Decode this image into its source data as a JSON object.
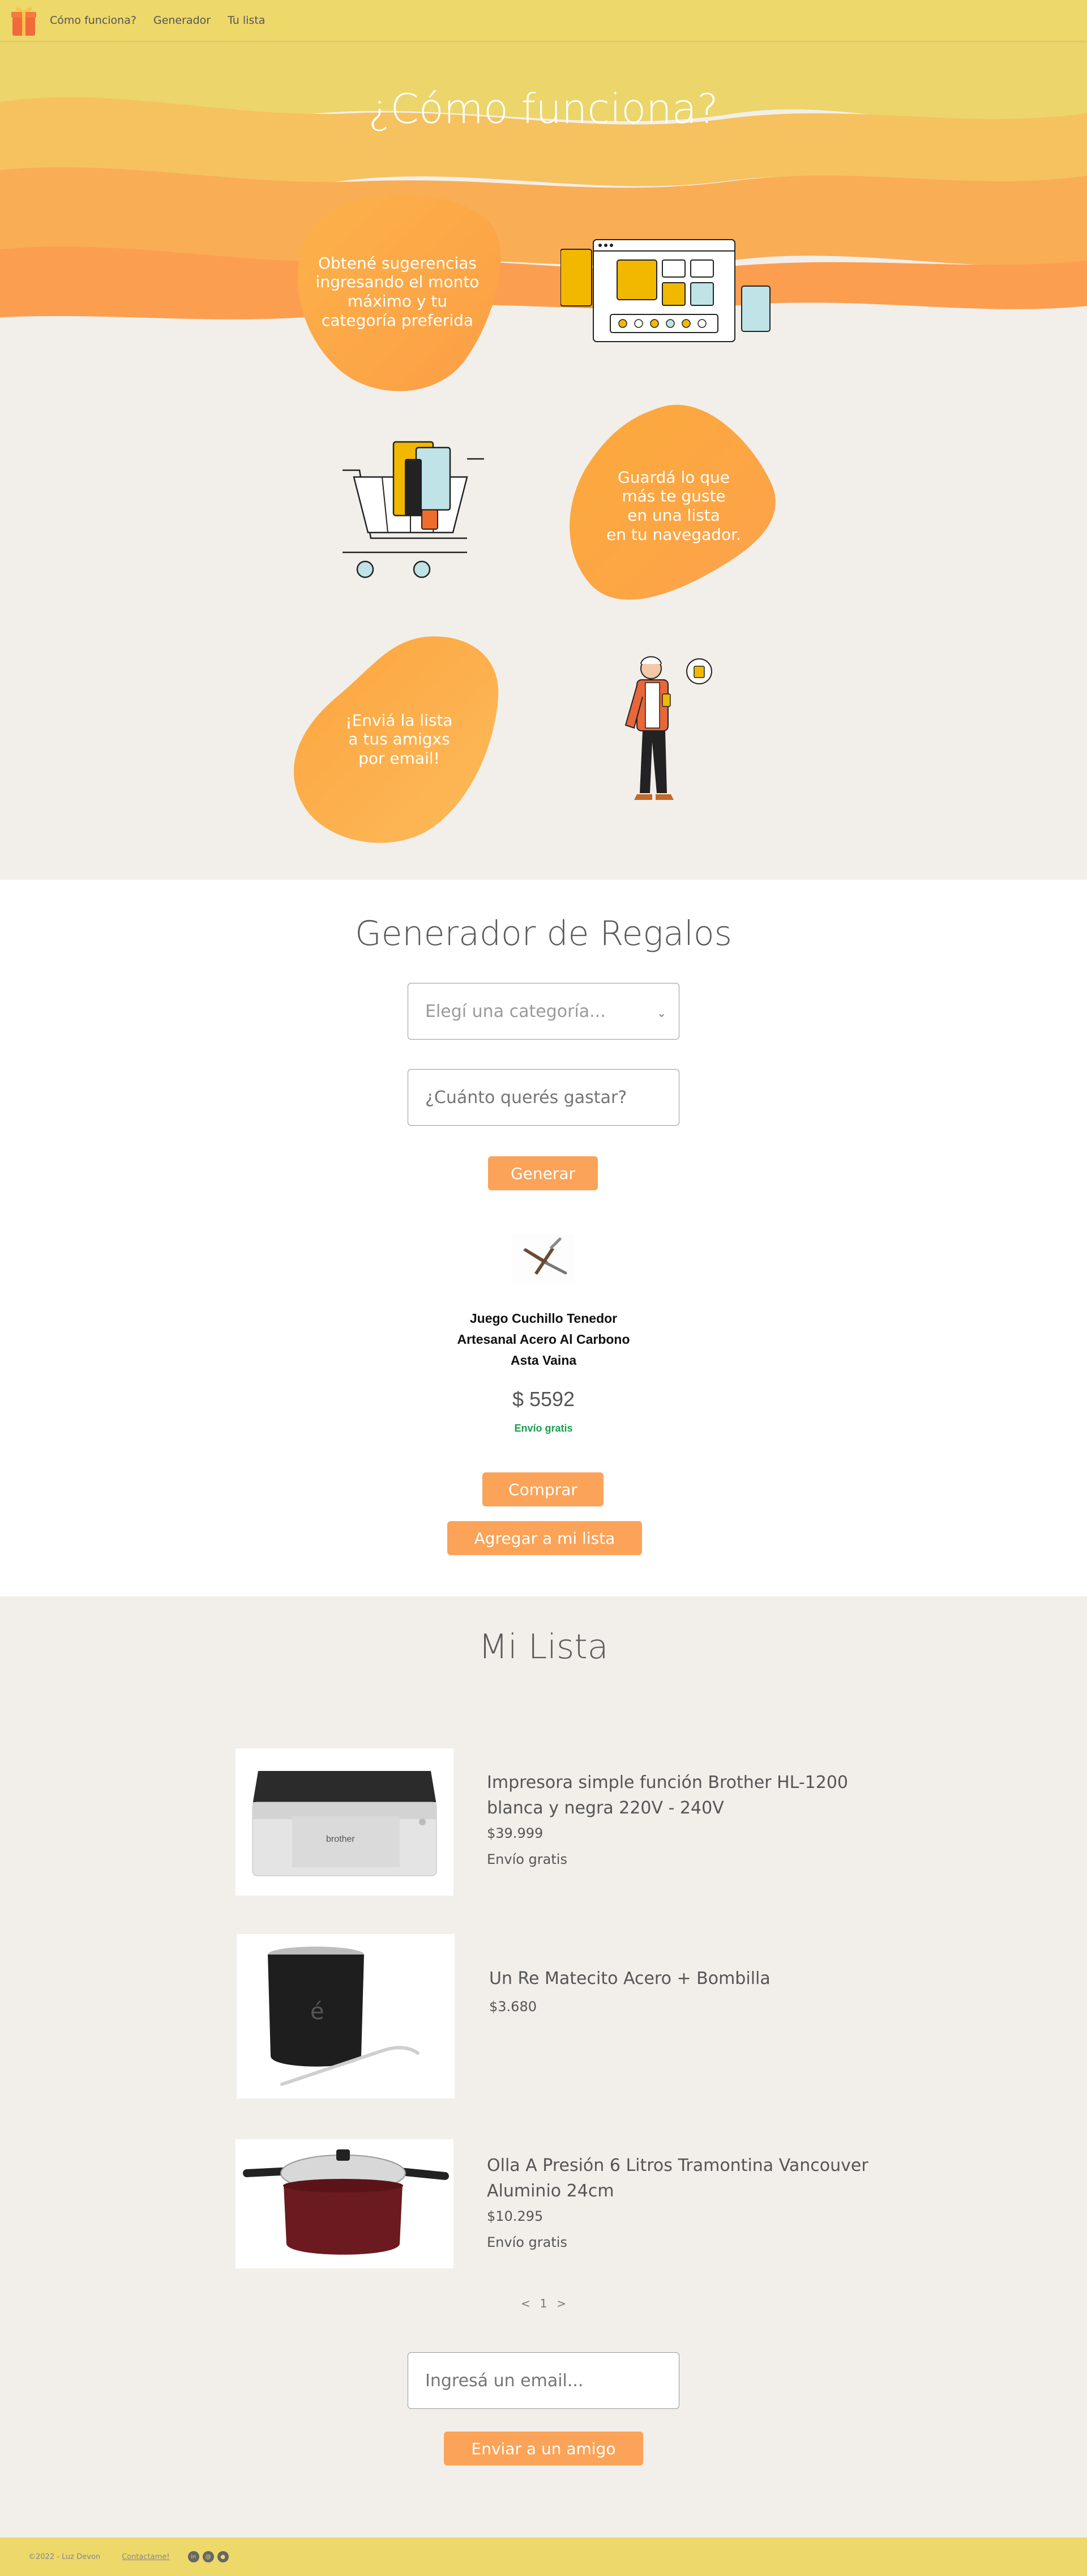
{
  "nav": {
    "links": [
      "Cómo funciona?",
      "Generador",
      "Tu lista"
    ]
  },
  "howto": {
    "title": "¿Cómo funciona?",
    "step1_lines": [
      "Obtené sugerencias",
      "ingresando el monto",
      "máximo y tu",
      "categoría preferida"
    ],
    "step2_lines": [
      "Guardá lo que",
      "más te guste",
      "en una lista",
      "en tu navegador."
    ],
    "step3_lines": [
      "¡Enviá la lista",
      "a tus amigxs",
      "por email!"
    ]
  },
  "generator": {
    "title": "Generador de Regalos",
    "category_placeholder": "Elegí una categoría...",
    "amount_placeholder": "¿Cuánto querés gastar?",
    "generate_label": "Generar",
    "product": {
      "name_lines": [
        "Juego Cuchillo Tenedor",
        "Artesanal Acero Al Carbono",
        "Asta Vaina"
      ],
      "price": "$ 5592",
      "shipping": "Envío gratis"
    },
    "buy_label": "Comprar",
    "add_label": "Agregar a mi lista"
  },
  "lista": {
    "title": "Mi Lista",
    "items": [
      {
        "name_lines": [
          "Impresora simple función Brother HL-1200",
          "blanca y negra 220V - 240V"
        ],
        "price": "$39.999",
        "shipping": "Envío gratis",
        "image": "printer-image",
        "brand": "brother"
      },
      {
        "name_lines": [
          "Un Re Matecito Acero + Bombilla"
        ],
        "price": "$3.680",
        "shipping": "",
        "image": "mate-image"
      },
      {
        "name_lines": [
          "Olla A Presión 6 Litros Tramontina Vancouver",
          "Aluminio 24cm"
        ],
        "price": "$10.295",
        "shipping": "Envío gratis",
        "image": "pressure-cooker-image"
      }
    ],
    "pager": {
      "prev": "<",
      "page": "1",
      "next": ">"
    },
    "email_placeholder": "Ingresá un email...",
    "send_label": "Enviar a un amigo"
  },
  "footer": {
    "copyright": "©2022 - Luz Devon",
    "contact": "Contactame!"
  },
  "colors": {
    "accent": "#fba358",
    "navbar": "#edd86a",
    "background": "#f2efeb",
    "shipping_green": "#1a9d4f"
  },
  "icons": [
    "gift-icon",
    "chevron-down-icon",
    "linkedin-icon",
    "email-icon",
    "github-icon"
  ]
}
